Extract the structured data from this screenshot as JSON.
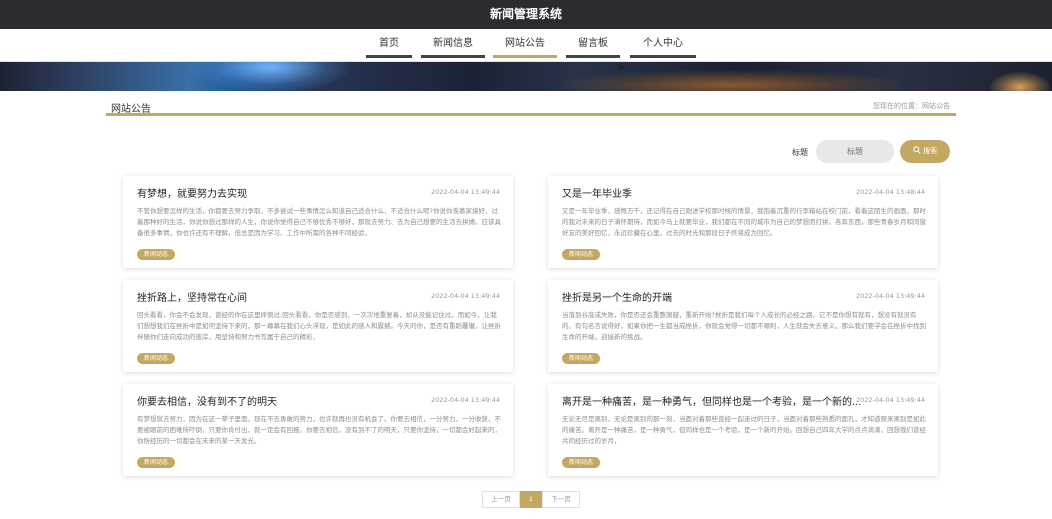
{
  "app": {
    "title": "新闻管理系统"
  },
  "nav": {
    "items": [
      {
        "label": "首页"
      },
      {
        "label": "新闻信息"
      },
      {
        "label": "网站公告"
      },
      {
        "label": "留言板"
      },
      {
        "label": "个人中心"
      }
    ]
  },
  "section": {
    "title": "网站公告",
    "position_label": "您现在的位置：",
    "position_value": "网站公告"
  },
  "search": {
    "label": "标题",
    "placeholder": "标题",
    "button_label": "搜索",
    "icon": "search-icon"
  },
  "cards": [
    {
      "title": "有梦想，就要努力去实现",
      "date": "2022-04-04 13:49:44",
      "summary": "不管你想要怎样的生活，你都要去努力争取，不多尝试一些事情怎么知道自己适合什么、不适合什么呢?你说你羡慕家境好、过着那种好的生活，你说你想过那样的人生，你说你觉得自己不够优秀不够好，那就去努力、去为自己想要的生活去拼搏。应该具备很多事情，你也许还有不理解，但总是因为学习、工作中所需的各种不同经验，",
      "tag": "新闻动态"
    },
    {
      "title": "又是一年毕业季",
      "date": "2022-04-04 13:48:44",
      "summary": "又是一年毕业季，感慨万千，还记得在自己刚进学校那时候的情景，我抱着沉重的行李箱站在校门前，看着这陌生的画面，那时的我对未来的日子满怀期待，而如今马上就要毕业，我们都在不同的城市为自己的梦想而打拼，各奔东西，那些青春岁月和同窗好友的美好回忆，永远珍藏在心里。过去的时光和那段日子终将成为回忆。",
      "tag": "新闻动态"
    },
    {
      "title": "挫折路上，坚持常在心间",
      "date": "2022-04-04 13:49:44",
      "summary": "回头看看，你会不会发现，曾经的你在这里摔倒过;回头看看，你是否感到，一次次地重复着，却从没能记住过。而如今，让我们想想我们在挫折中是如何坚持下来的，那一幕幕在我们心头浮现，是如此的感人和震撼。今天的你，是否有重蹈覆辙，让挫折伴随你们走向成功的彼岸，用坚持和努力书写属于自己的精彩，",
      "tag": "新闻动态"
    },
    {
      "title": "挫折是另一个生命的开端",
      "date": "2022-04-04 13:49:44",
      "summary": "当落到谷底或失败，你是否还会重整旗鼓，重新开始?挫折是我们每个人成长的必经之路，它不是你想有就有，想没有就没有的。有句名言说得好，如果你把一生都当成挫折，你就会觉得一切都不顺利，人生就会失去意义。那么我们要学会在挫折中找到生命的开端，迎接新的挑战。",
      "tag": "新闻动态"
    },
    {
      "title": "你要去相信，没有到不了的明天",
      "date": "2022-04-04 13:49:44",
      "summary": "有梦想就去努力，因为在这一辈子里面，现在不去勇敢的努力，也许就再也没有机会了。你要去相信，一分努力，一分收获，不要被眼前的困难所吓倒，只要你肯付出，就一定会有回报。你要去相信，没有到不了的明天，只要你坚持，一切都会好起来的，你所经历的一切都会在未来的某一天发光。",
      "tag": "新闻动态"
    },
    {
      "title": "离开是一种痛苦，是一种勇气，但同样也是一个考验，是一个新的...",
      "date": "2022-04-04 13:49:44",
      "summary": "无论无尽是离别，无论是离别的那一刻，当面对着那些曾经一起走过的日子，当面对着那些熟悉的面孔，才知道原来离别是如此的痛苦。离开是一种痛苦，是一种勇气，但同样也是一个考验，是一个新的开始。回想自己四年大学的点点滴滴，回想我们曾经共同经历过的岁月，",
      "tag": "新闻动态"
    }
  ],
  "pager": {
    "prev": "上一页",
    "current": "1",
    "next": "下一页"
  }
}
